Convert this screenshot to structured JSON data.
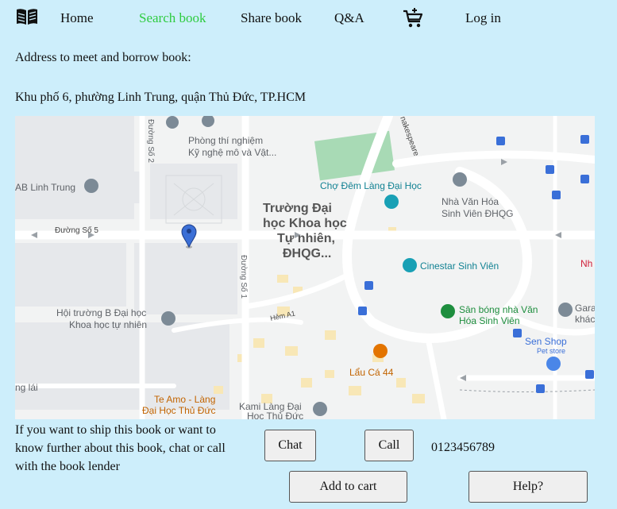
{
  "nav": {
    "home": "Home",
    "search": "Search book",
    "share": "Share book",
    "qa": "Q&A",
    "login": "Log in"
  },
  "address": {
    "heading": "Address to meet and borrow book:",
    "value": "Khu phố 6, phường Linh Trung, quận Thủ Đức, TP.HCM"
  },
  "map": {
    "labels": {
      "lab1": "Phòng thí nghiệm",
      "lab2": "Kỹ nghệ mô và Vật...",
      "road_so2": "Đường Số 2",
      "road_so1": "Đường Số 1",
      "road_so5": "Đường Số 5",
      "nakespeare": "nakespeare",
      "ab_linh_trung": "AB Linh Trung",
      "cho_dem": "Chợ Đêm Làng Đại Học",
      "truong1": "Trường Đại",
      "truong2": "học Khoa học",
      "truong3": "Tự nhiên,",
      "truong4": "ĐHQG...",
      "nha_van_hoa1": "Nhà Văn Hóa",
      "nha_van_hoa2": "Sinh Viên ĐHQG",
      "cinestar": "Cinestar Sinh Viên",
      "nh": "Nh",
      "hoi_truong1": "Hội trường B Đại học",
      "hoi_truong2": "Khoa học tự nhiên",
      "hem_a1": "Hẻm A1",
      "san_bong1": "Sân bóng nhà Văn",
      "san_bong2": "Hóa Sinh Viên",
      "gara1": "Gara",
      "gara2": "khác",
      "sen_shop": "Sen Shop",
      "pet_store": "Pet store",
      "lau_ca": "Lẩu Cá 44",
      "ng_lai": "ng lái",
      "te_amo1": "Te Amo - Làng",
      "te_amo2": "Đại Học Thủ Đức",
      "kami1": "Kami Làng Đại",
      "kami2": "Học Thủ Đức"
    },
    "colors": {
      "background": "#f2f3f3",
      "road": "#ffffff",
      "park": "#a8dab5",
      "marker": "#3b6fd6",
      "poi_gray": "#7c8a96",
      "poi_teal": "#19a0b5",
      "poi_green": "#1e8e3e",
      "poi_orange": "#e37400"
    }
  },
  "contact": {
    "info": "If you want to ship this book or want to know further about this book, chat or call with the book lender",
    "chat_label": "Chat",
    "call_label": "Call",
    "phone": "0123456789"
  },
  "actions": {
    "add_to_cart": "Add to cart",
    "help": "Help?"
  },
  "icons": {
    "logo": "book-icon",
    "cart": "cart-icon",
    "map_pin": "map-pin-icon"
  }
}
